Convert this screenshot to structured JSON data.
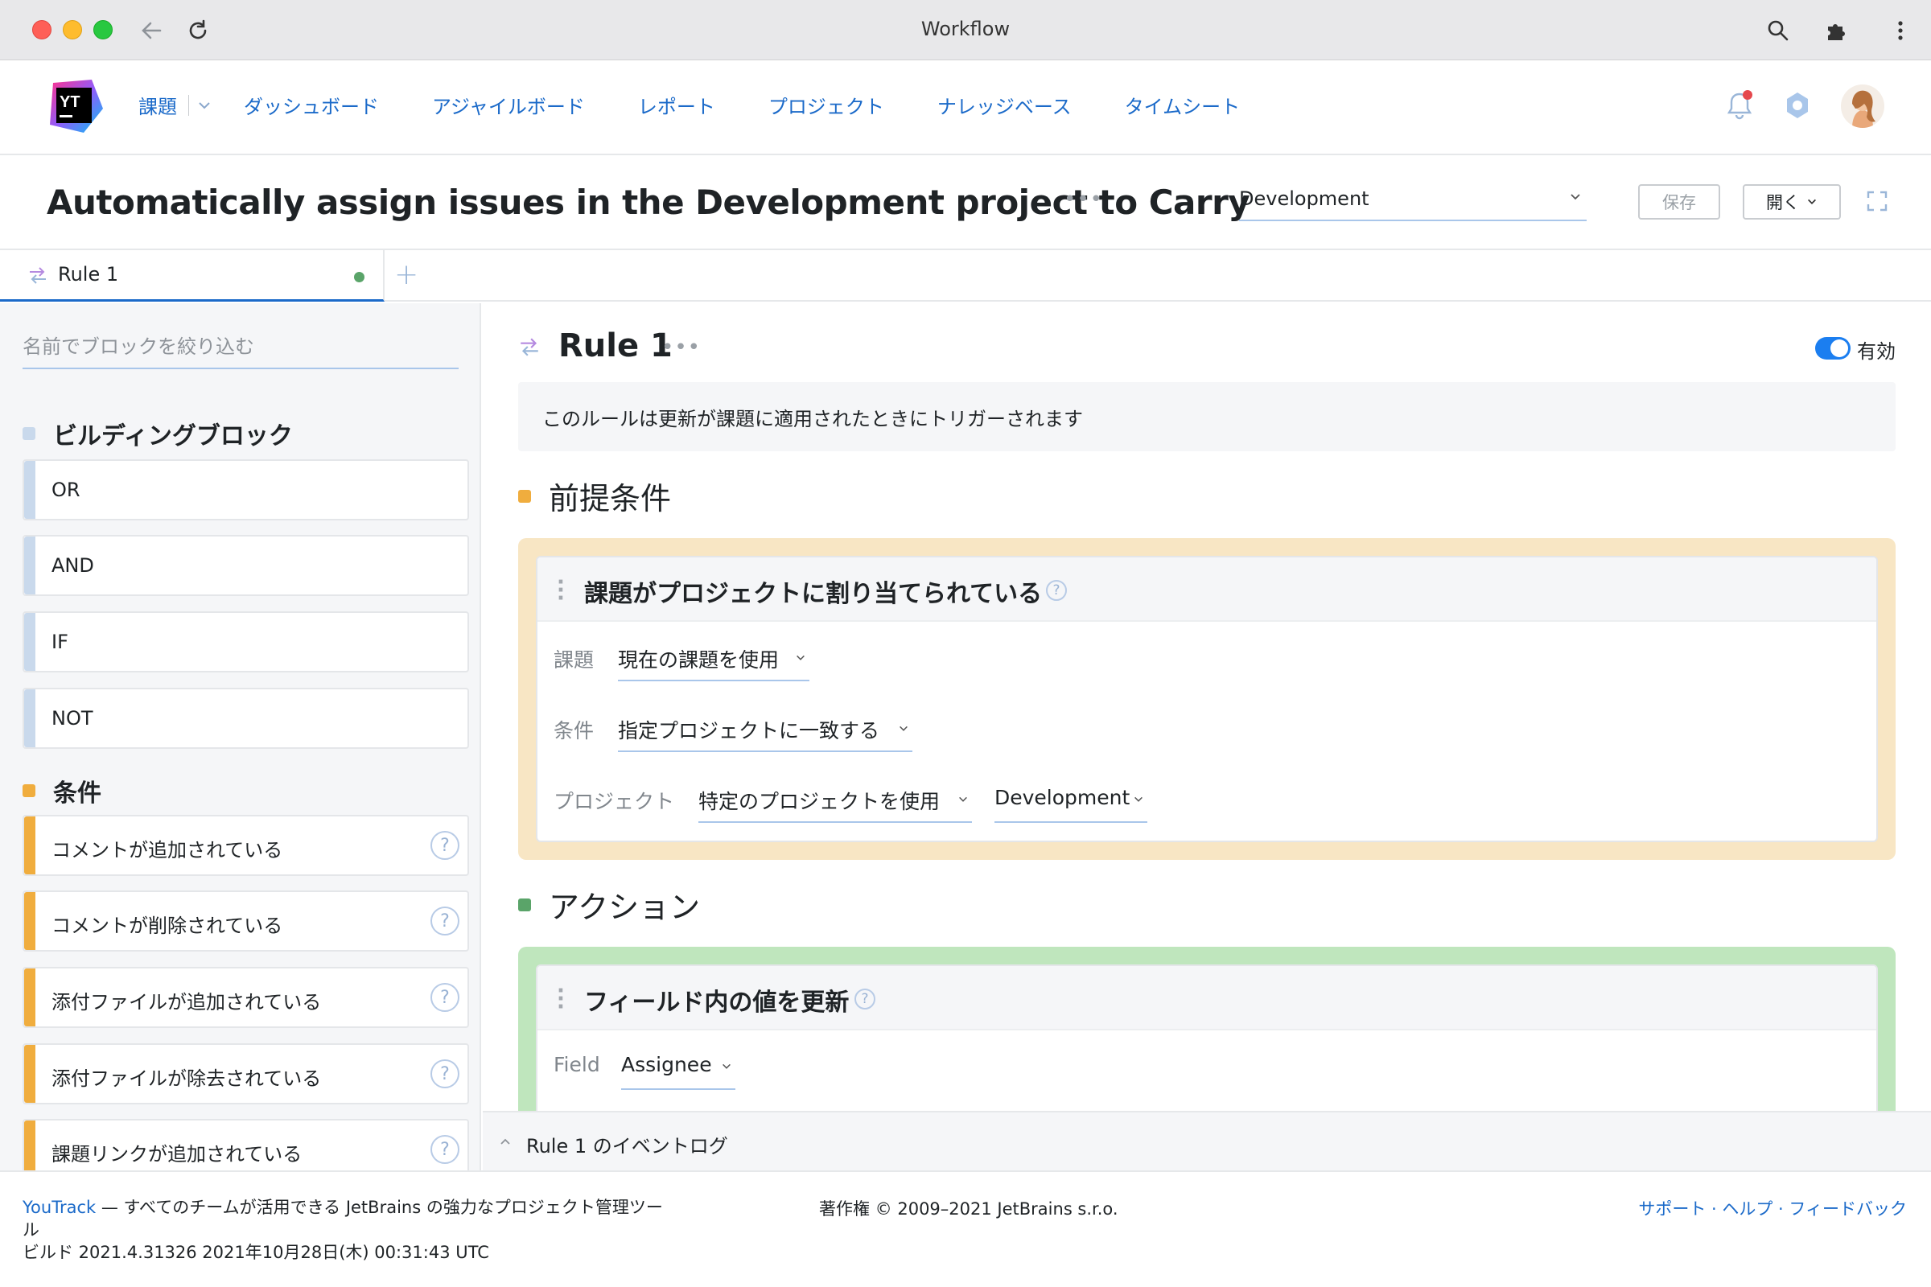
{
  "browser": {
    "title": "Workflow"
  },
  "nav": {
    "items": [
      "課題",
      "ダッシュボード",
      "アジャイルボード",
      "レポート",
      "プロジェクト",
      "ナレッジベース",
      "タイムシート"
    ]
  },
  "header": {
    "page_title": "Automatically assign issues in the Development project to Carry",
    "more": "•••",
    "project_select": "Development",
    "save_label": "保存",
    "open_label": "開く"
  },
  "tabs": [
    {
      "label": "Rule 1"
    }
  ],
  "sidebar": {
    "filter_placeholder": "名前でブロックを絞り込む",
    "building_title": "ビルディングブロック",
    "building_blocks": [
      "OR",
      "AND",
      "IF",
      "NOT"
    ],
    "conditions_title": "条件",
    "conditions": [
      "コメントが追加されている",
      "コメントが削除されている",
      "添付ファイルが追加されている",
      "添付ファイルが除去されている",
      "課題リンクが追加されている"
    ],
    "help_glyph": "?"
  },
  "rule": {
    "title": "Rule 1",
    "enabled_label": "有効",
    "trigger_text": "このルールは更新が課題に適用されたときにトリガーされます",
    "prereq_title": "前提条件",
    "prereq_card": {
      "title": "課題がプロジェクトに割り当てられている",
      "issue_label": "課題",
      "issue_value": "現在の課題を使用",
      "cond_label": "条件",
      "cond_value": "指定プロジェクトに一致する",
      "project_label": "プロジェクト",
      "project_value": "特定のプロジェクトを使用",
      "project_name": "Development"
    },
    "action_title": "アクション",
    "action_card": {
      "title": "フィールド内の値を更新",
      "field_label": "Field",
      "field_value": "Assignee"
    }
  },
  "eventlog": {
    "label": "Rule 1 のイベントログ"
  },
  "footer": {
    "link": "YouTrack",
    "description": " — すべてのチームが活用できる JetBrains の強力なプロジェクト管理ツール",
    "build": "ビルド 2021.4.31326 2021年10月28日(木) 00:31:43 UTC",
    "copyright": "著作権 © 2009–2021 JetBrains s.r.o.",
    "links": "サポート · ヘルプ · フィードバック"
  },
  "colors": {
    "accent": "#1b6ac9",
    "building": "#c9d9ec",
    "conditions": "#f0ad3e",
    "prereq_bg": "#f8e6c4",
    "action": "#5aa469",
    "action_bg": "#bfe6bd"
  }
}
